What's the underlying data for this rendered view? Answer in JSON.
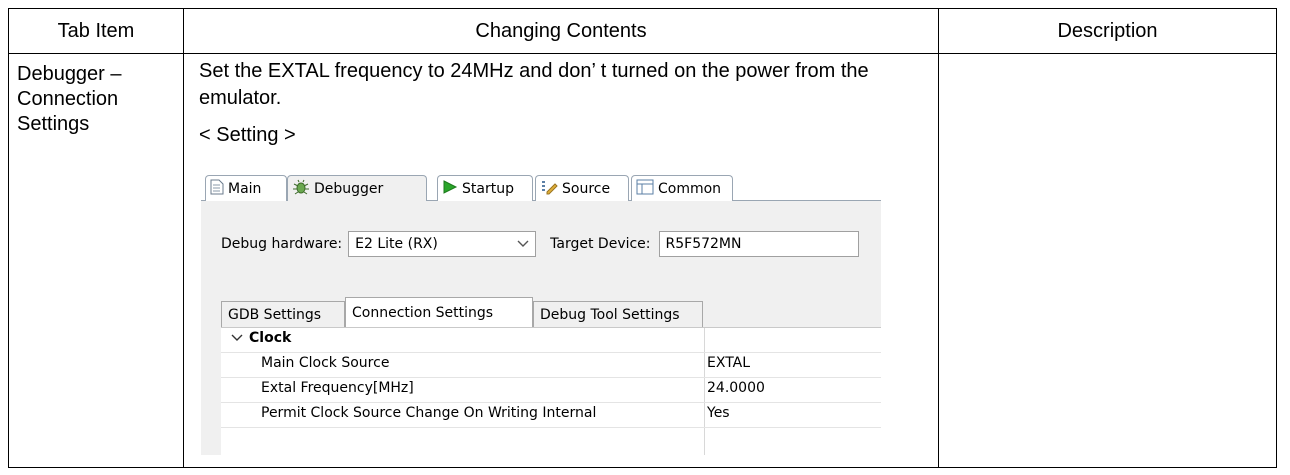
{
  "table": {
    "headers": [
      "Tab Item",
      "Changing Contents",
      "Description"
    ],
    "tab_item": [
      "Debugger –",
      "Connection",
      "Settings"
    ],
    "changes_text": "Set the EXTAL frequency to 24MHz and don’ t turned on the power from the emulator.",
    "setting_label": "< Setting >",
    "description": ""
  },
  "screenshot": {
    "tabs": [
      {
        "label": "Main",
        "icon": "document-icon"
      },
      {
        "label": "Debugger",
        "icon": "bug-icon"
      },
      {
        "label": "Startup",
        "icon": "play-icon"
      },
      {
        "label": "Source",
        "icon": "source-icon"
      },
      {
        "label": "Common",
        "icon": "table-icon"
      }
    ],
    "debug_hardware_label": "Debug hardware:",
    "debug_hardware_value": "E2 Lite (RX)",
    "target_device_label": "Target Device:",
    "target_device_value": "R5F572MN",
    "sub_tabs": [
      "GDB Settings",
      "Connection Settings",
      "Debug Tool Settings"
    ],
    "grid": {
      "group": "Clock",
      "rows": [
        {
          "name": "Main Clock Source",
          "value": "EXTAL"
        },
        {
          "name": "Extal Frequency[MHz]",
          "value": "24.0000"
        },
        {
          "name": "Permit Clock Source Change On Writing Internal",
          "value": "Yes"
        }
      ]
    },
    "colors": {
      "play": "#2aa52a",
      "bug": "#4a8a2a",
      "border": "#9aa6b3"
    }
  }
}
